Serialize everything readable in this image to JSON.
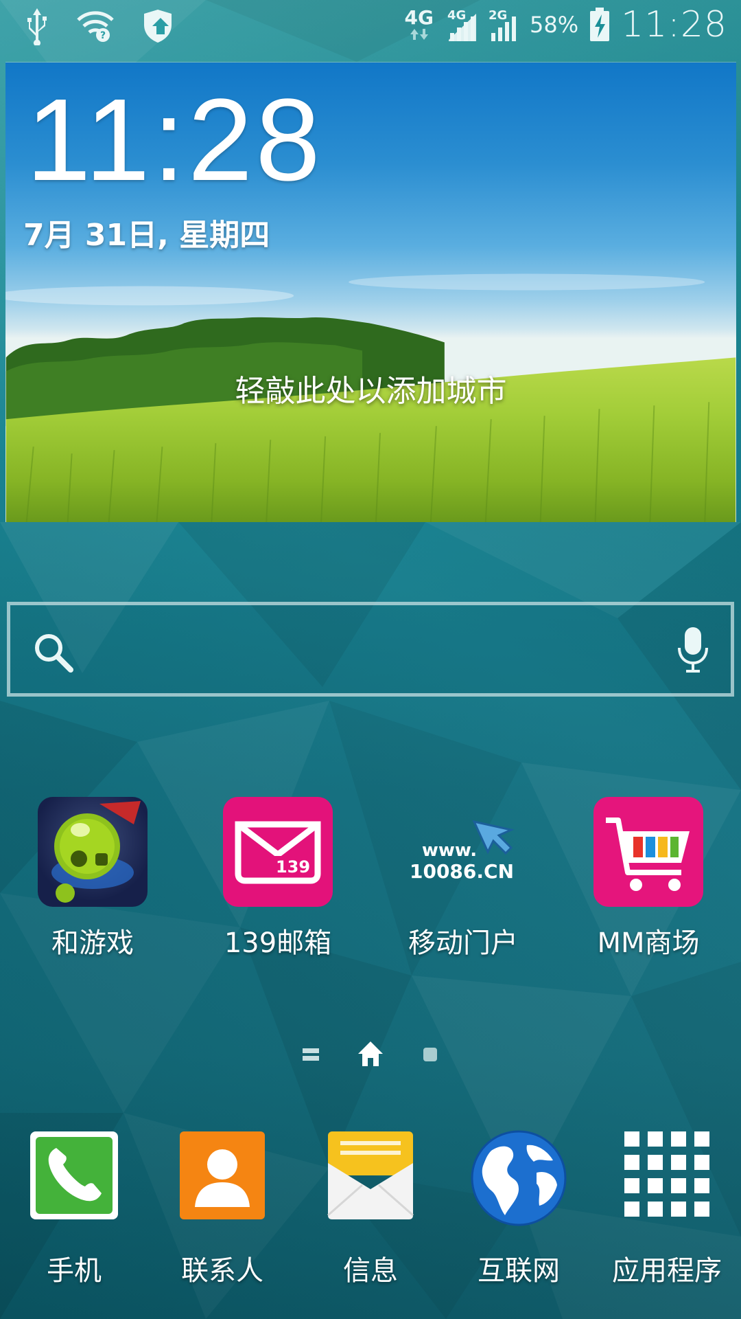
{
  "status_bar": {
    "network_4g": "4G",
    "sim1_label": "4G",
    "sim2_label": "2G",
    "battery_percent": "58%",
    "time": "11:28",
    "icons": [
      "usb-icon",
      "wifi-icon",
      "shield-update-icon",
      "data-arrows-icon",
      "signal-icon",
      "signal-icon",
      "battery-charging-icon"
    ]
  },
  "weather_widget": {
    "time": "11:28",
    "date": "7月 31日, 星期四",
    "city_prompt": "轻敲此处以添加城市"
  },
  "search": {
    "icons": [
      "search-icon",
      "microphone-icon"
    ]
  },
  "home_apps": [
    {
      "label": "和游戏",
      "icon": "game-robot-icon"
    },
    {
      "label": "139邮箱",
      "icon": "mail-139-icon",
      "badge": "139"
    },
    {
      "label": "移动门户",
      "icon": "www-10086-icon",
      "logo_text_1": "www.",
      "logo_text_2": "10086.CN"
    },
    {
      "label": "MM商场",
      "icon": "shopping-cart-icon"
    }
  ],
  "pager": {
    "icons": [
      "menu-page-icon",
      "home-page-icon",
      "page-dot-icon"
    ],
    "current": "home"
  },
  "dock": [
    {
      "label": "手机",
      "icon": "phone-icon"
    },
    {
      "label": "联系人",
      "icon": "contacts-icon"
    },
    {
      "label": "信息",
      "icon": "messages-icon"
    },
    {
      "label": "互联网",
      "icon": "globe-icon"
    },
    {
      "label": "应用程序",
      "icon": "apps-grid-icon"
    }
  ],
  "colors": {
    "mm_pink": "#e5157c",
    "mail_pink": "#e3127a",
    "phone_green": "#44b23a",
    "contacts_orange": "#f58512",
    "globe_blue": "#1c6fcf"
  }
}
